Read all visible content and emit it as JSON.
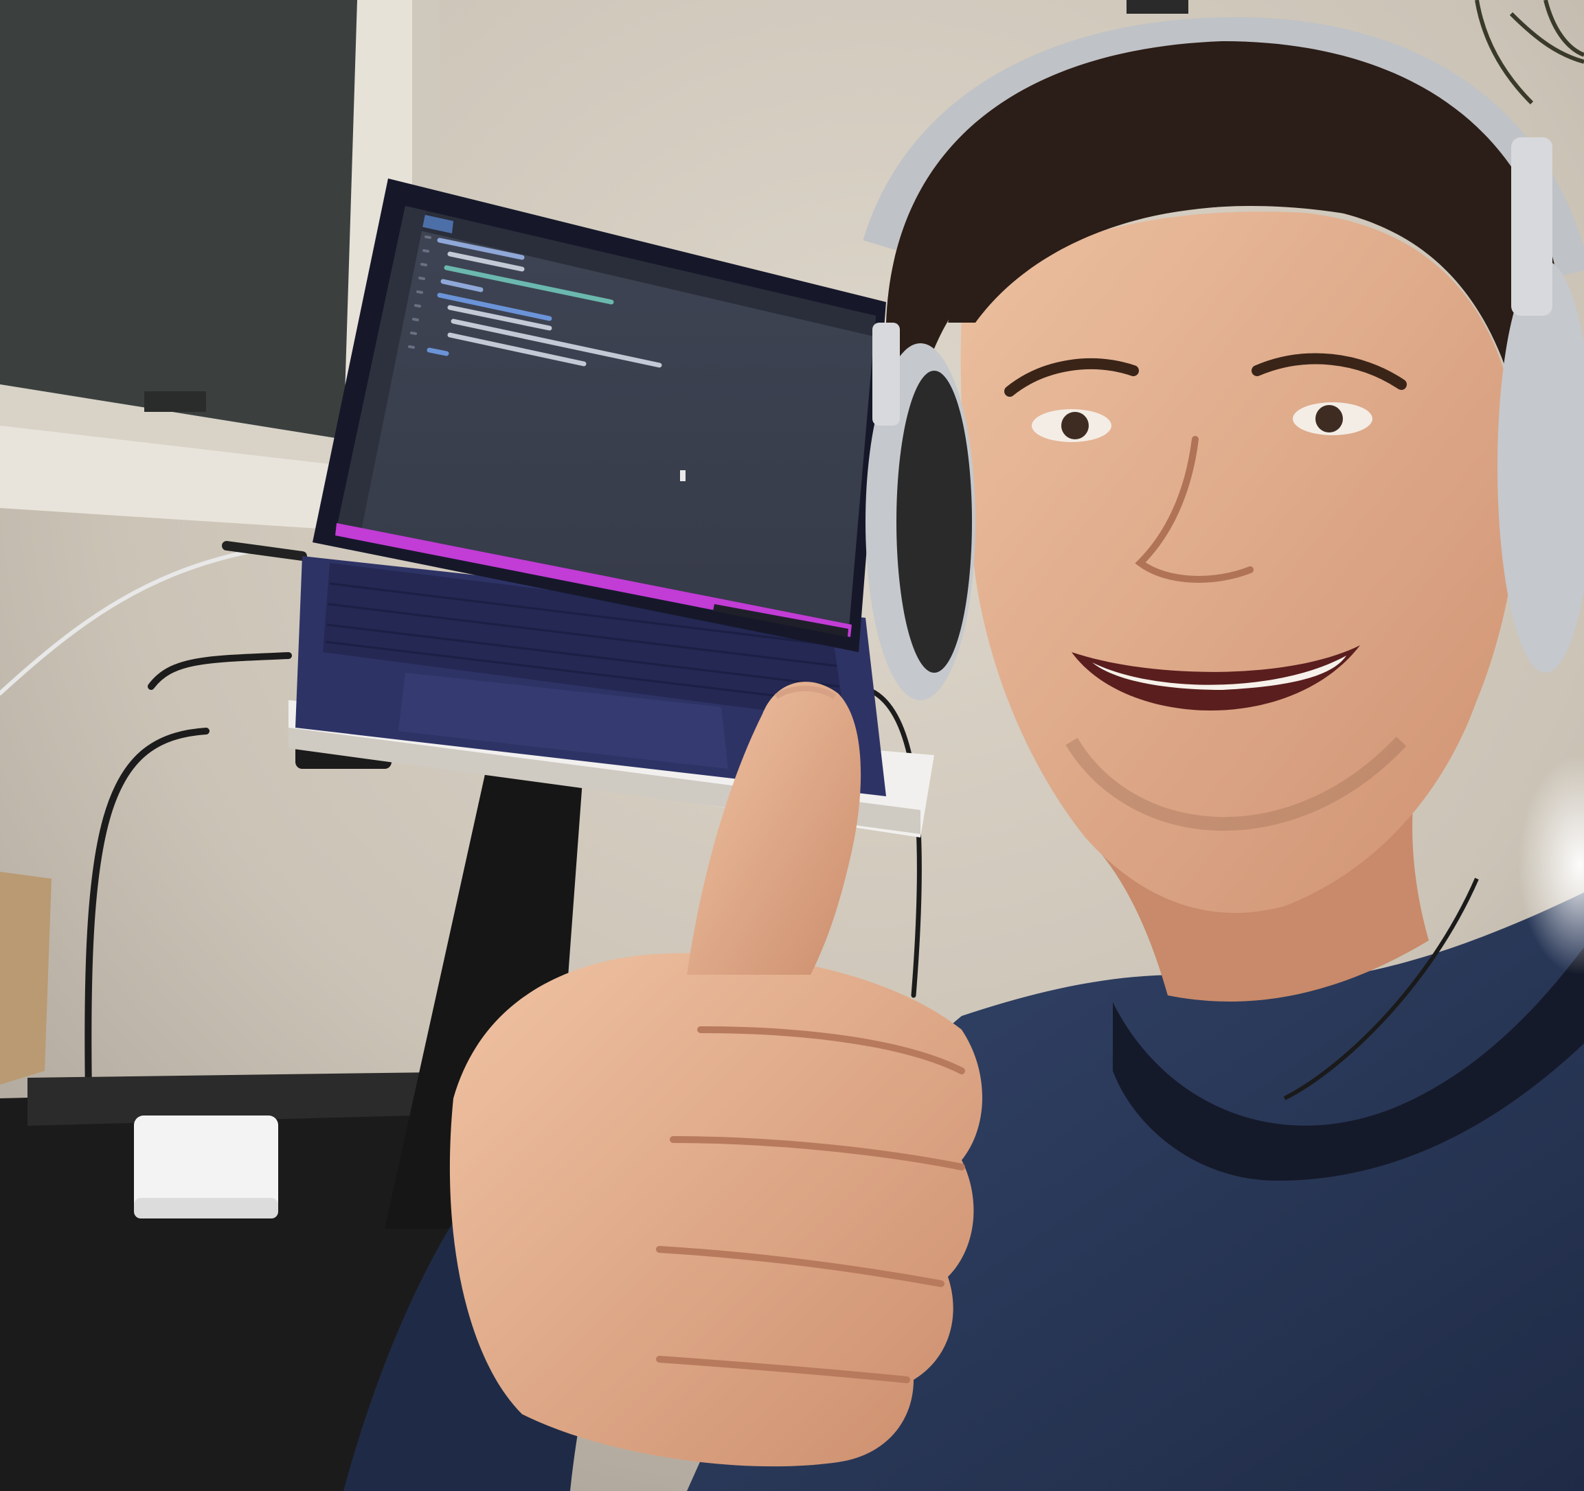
{
  "scene": {
    "subject": "person-with-headphones",
    "gesture": "thumbs-up",
    "objects": [
      "window",
      "laptop",
      "laptop-stand",
      "power-adapter",
      "cables",
      "headphones",
      "plant"
    ]
  },
  "laptop_screen": {
    "editor_theme": "dark",
    "code_line_count": 9,
    "has_cursor": true,
    "status_bar_accent": "#c23cd6"
  },
  "palette": {
    "wall": "#d6cfc3",
    "window_glass": "#3b403f",
    "screen_bg": "#3a404e",
    "laptop_body": "#2e3366",
    "shirt": "#2a3a5c",
    "skin": "#e0a785",
    "hair": "#2b1d17",
    "headphone_silver": "#b9bcc0"
  }
}
